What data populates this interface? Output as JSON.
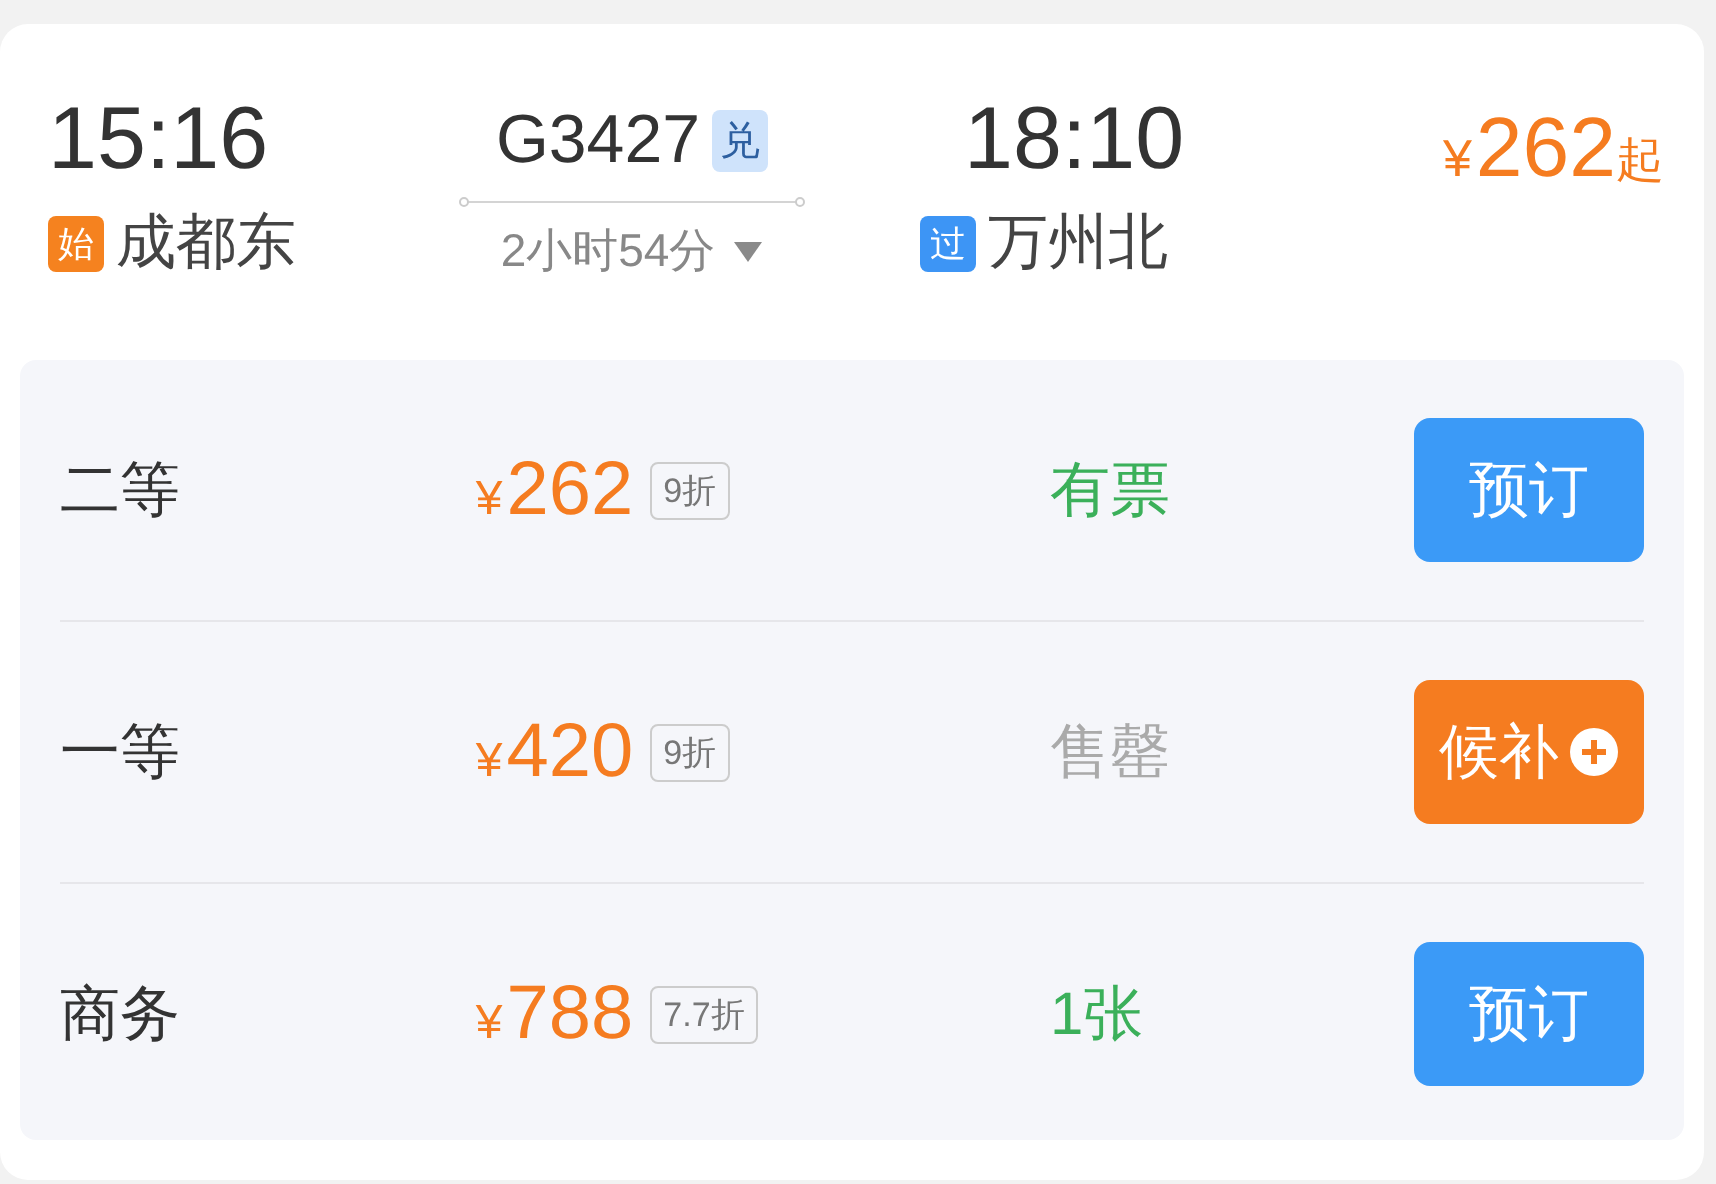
{
  "departure": {
    "time": "15:16",
    "station": "成都东",
    "badge": {
      "text": "始",
      "color": "#f5821f"
    }
  },
  "train": {
    "number": "G3427",
    "tag": "兑",
    "duration": "2小时54分"
  },
  "arrival": {
    "time": "18:10",
    "station": "万州北",
    "badge": {
      "text": "过",
      "color": "#3d95f5"
    }
  },
  "lowest_price": {
    "currency": "¥",
    "amount": "262",
    "suffix": "起"
  },
  "seats": [
    {
      "class": "二等",
      "currency": "¥",
      "price": "262",
      "discount": "9折",
      "kind": "available",
      "availability": "有票",
      "button": "预订"
    },
    {
      "class": "一等",
      "currency": "¥",
      "price": "420",
      "discount": "9折",
      "kind": "sold_out",
      "availability": "售罄",
      "button": "候补"
    },
    {
      "class": "商务",
      "currency": "¥",
      "price": "788",
      "discount": "7.7折",
      "kind": "available",
      "availability": "1张",
      "button": "预订"
    }
  ]
}
